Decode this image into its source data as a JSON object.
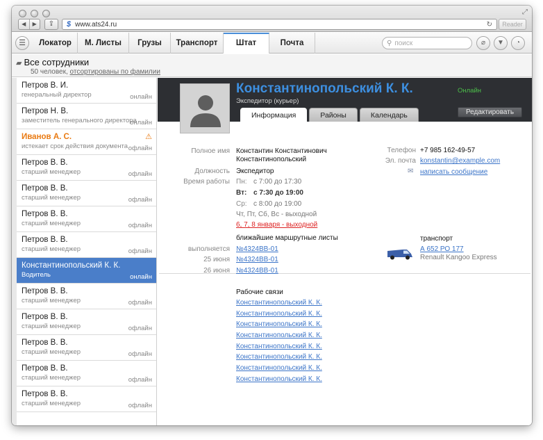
{
  "browser": {
    "url": "www.ats24.ru",
    "reader_label": "Reader"
  },
  "app": {
    "tabs": [
      "Локатор",
      "М. Листы",
      "Грузы",
      "Транспорт",
      "Штат",
      "Почта"
    ],
    "active_tab": "Штат",
    "search_placeholder": "поиск"
  },
  "staff": {
    "title": "Все сотрудники",
    "subtitle_prefix": "50 человек, ",
    "subtitle_link": "отсортированы по фамилии",
    "items": [
      {
        "name": "Петров В. И.",
        "role": "генеральный директор",
        "status": "онлайн"
      },
      {
        "name": "Петров Н. В.",
        "role": "заместитель генерального директора",
        "status": "онлайн"
      },
      {
        "name": "Иванов А. С.",
        "role": "истекает срок действия документа",
        "status": "офлайн",
        "warning": true
      },
      {
        "name": "Петров В. В.",
        "role": "старший менеджер",
        "status": "офлайн"
      },
      {
        "name": "Петров В. В.",
        "role": "старший менеджер",
        "status": "офлайн"
      },
      {
        "name": "Петров В. В.",
        "role": "старший менеджер",
        "status": "офлайн"
      },
      {
        "name": "Петров В. В.",
        "role": "старший менеджер",
        "status": "офлайн"
      },
      {
        "name": "Константинопольский К. К.",
        "role": "Водитель",
        "status": "онлайн",
        "selected": true
      },
      {
        "name": "Петров В. В.",
        "role": "старший менеджер",
        "status": "офлайн"
      },
      {
        "name": "Петров В. В.",
        "role": "старший менеджер",
        "status": "офлайн"
      },
      {
        "name": "Петров В. В.",
        "role": "старший менеджер",
        "status": "офлайн"
      },
      {
        "name": "Петров В. В.",
        "role": "старший менеджер",
        "status": "офлайн"
      },
      {
        "name": "Петров В. В.",
        "role": "старший менеджер",
        "status": "офлайн"
      }
    ]
  },
  "profile": {
    "name": "Константинопольский К. К.",
    "position": "Экспедитор (курьер)",
    "online": "Онлайн",
    "edit_label": "Редактировать",
    "tabs": [
      "Информация",
      "Районы",
      "Календарь"
    ],
    "full_name_label": "Полное имя",
    "full_name_line1": "Константин Константинович",
    "full_name_line2": "Константинопольский",
    "post_label": "Должность",
    "post_value": "Экспедитор",
    "hours_label": "Время работы",
    "hours": [
      {
        "day": "Пн:",
        "time": "с 7:00 до 17:30"
      },
      {
        "day": "Вт:",
        "time": "с 7:30 до 19:00"
      },
      {
        "day": "Ср:",
        "time": "с 8:00 до 19:00"
      }
    ],
    "weekend": "Чт, Пт, Сб, Вс - выходной",
    "holidays": "6, 7, 8 января - выходной",
    "phone_label": "Телефон",
    "phone": "+7 985 162-49-57",
    "email_label": "Эл. почта",
    "email": "konstantin@example.com",
    "message_link": "написать сообщение",
    "routes_title": "ближайшие маршрутные листы",
    "routes": [
      {
        "label": "выполняется",
        "value": "№4324ВВ-01"
      },
      {
        "label": "25 июня",
        "value": "№4324ВВ-01"
      },
      {
        "label": "26 июня",
        "value": "№4324ВВ-01"
      }
    ],
    "transport_title": "транспорт",
    "transport_plate": "А 652 РО 177",
    "transport_model": "Renault Kangoo Express",
    "links_title": "Рабочие связи",
    "links": [
      "Константинопольский К. К.",
      "Константинопольский К. К.",
      "Константинопольский К. К.",
      "Константинопольский К. К.",
      "Константинопольский К. К.",
      "Константинопольский К. К.",
      "Константинопольский К. К.",
      "Константинопольский К. К."
    ]
  }
}
